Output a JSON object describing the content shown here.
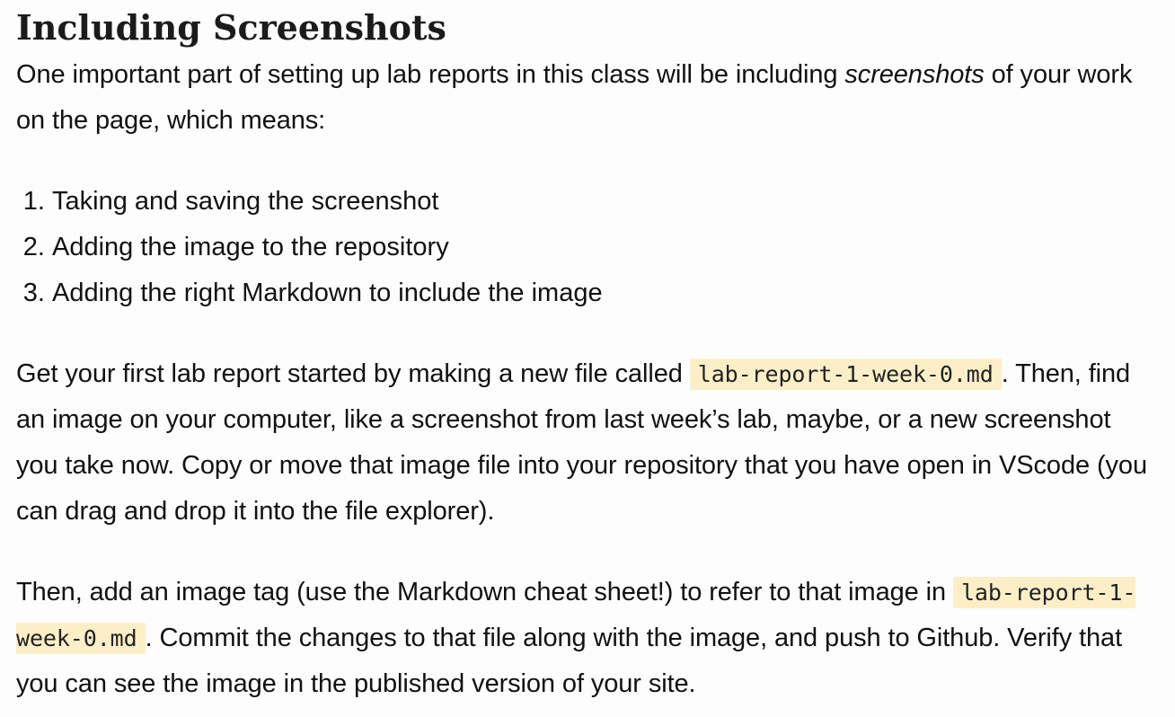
{
  "section": {
    "title": "Including Screenshots"
  },
  "intro": {
    "before": "One important part of setting up lab reports in this class will be including ",
    "emphasis": "screenshots",
    "after": " of your work on the page, which means:"
  },
  "steps": [
    "Taking and saving the screenshot",
    "Adding the image to the repository",
    "Adding the right Markdown to include the image"
  ],
  "para2": {
    "before": "Get your first lab report started by making a new file called ",
    "code": "lab-report-1-week-0.md",
    "after": ". Then, find an image on your computer, like a screenshot from last week’s lab, maybe, or a new screenshot you take now. Copy or move that image file into your repository that you have open in VScode (you can drag and drop it into the file explorer)."
  },
  "para3": {
    "before": "Then, add an image tag (use the Markdown cheat sheet!) to refer to that image in ",
    "code": "lab-report-1-week-0.md",
    "after": ". Commit the changes to that file along with the image, and push to Github. Verify that you can see the image in the published version of your site."
  },
  "colors": {
    "text": "#111111",
    "background": "#fdfdfd",
    "code_background": "#fcefc8"
  }
}
